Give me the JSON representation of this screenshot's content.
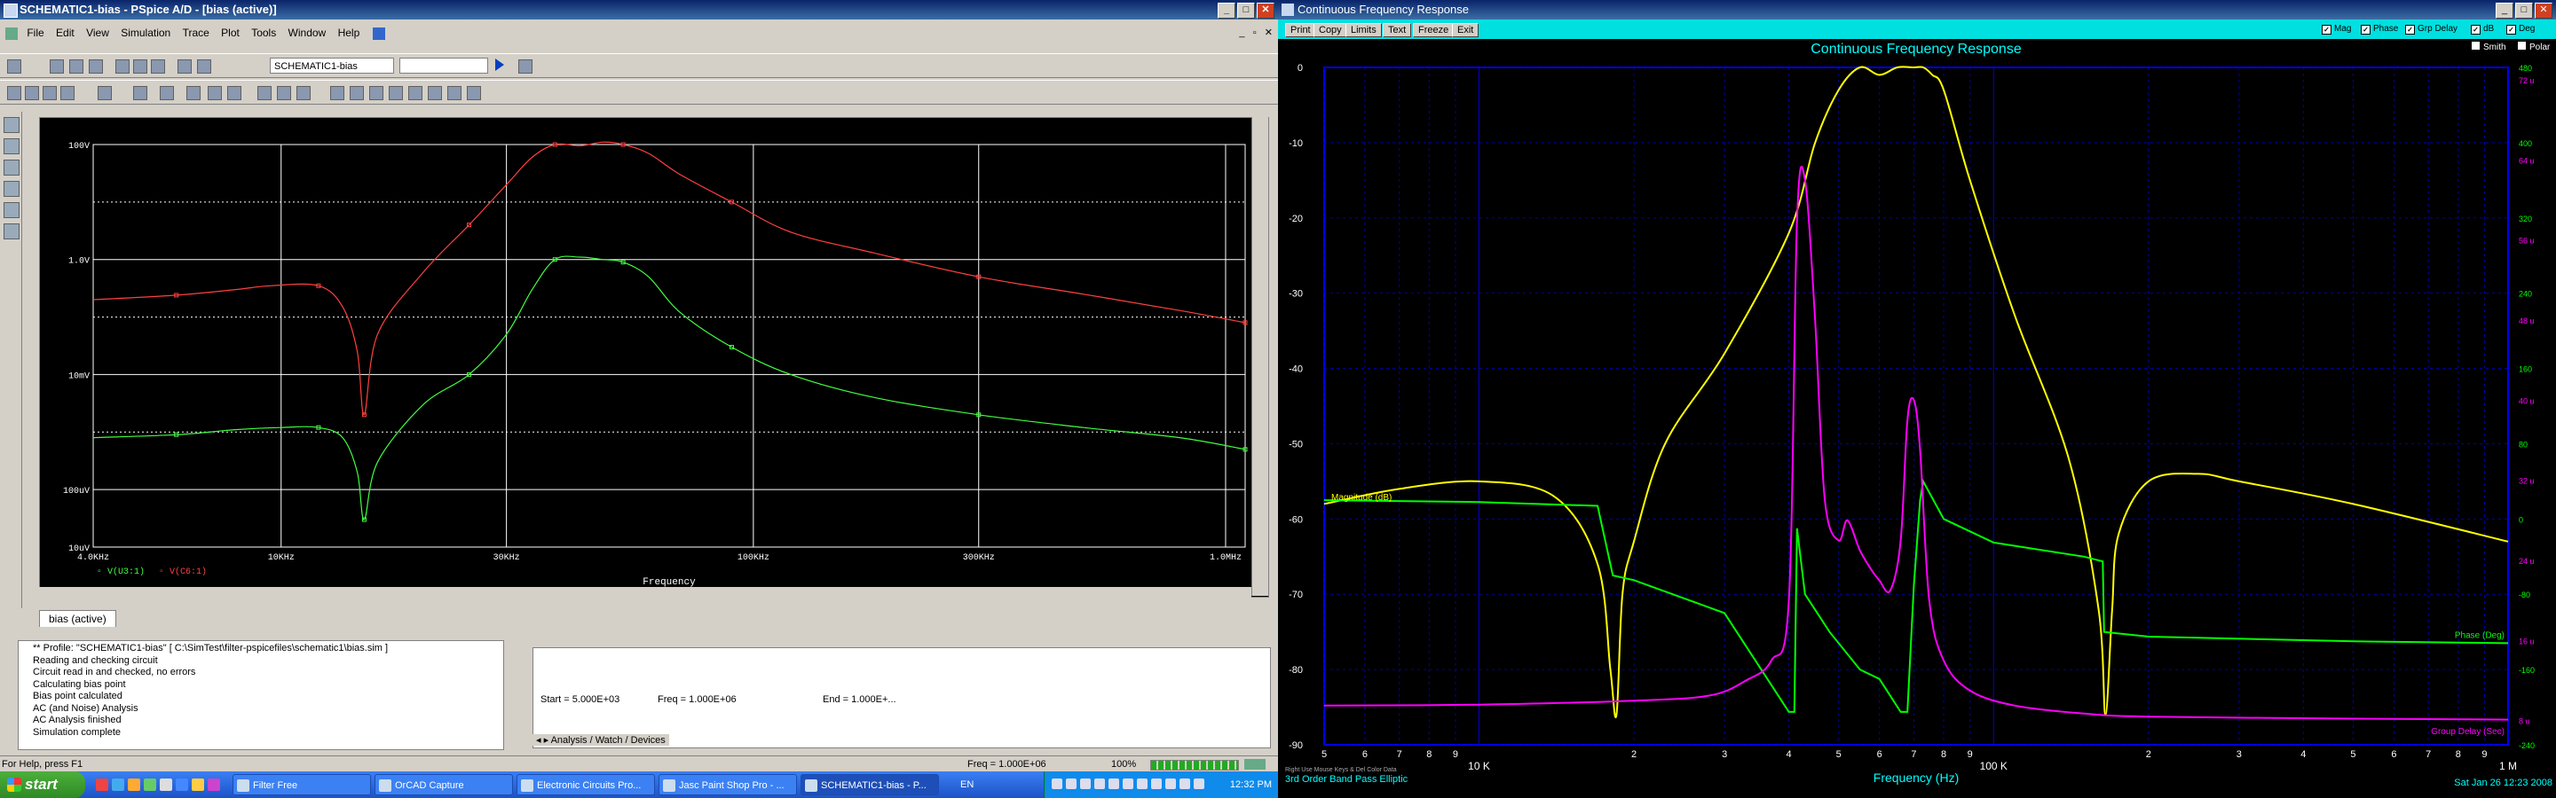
{
  "left_window": {
    "title": "SCHEMATIC1-bias - PSpice A/D - [bias (active)]",
    "menus": [
      "File",
      "Edit",
      "View",
      "Simulation",
      "Trace",
      "Plot",
      "Tools",
      "Window",
      "Help"
    ],
    "toolbar": {
      "profile_value": "SCHEMATIC1-bias",
      "second_value": ""
    },
    "plot": {
      "y_ticks": [
        "100V",
        "1.0V",
        "10mV",
        "100uV",
        "10uV"
      ],
      "x_ticks": [
        "4.0KHz",
        "10KHz",
        "30KHz",
        "100KHz",
        "300KHz",
        "1.0MHz"
      ],
      "x_label": "Frequency",
      "legend": [
        "V(U3:1)",
        "V(C6:1)"
      ]
    },
    "tab": "bias (active)",
    "output_lines": [
      "** Profile: \"SCHEMATIC1-bias\"  [ C:\\SimTest\\filter-pspicefiles\\schematic1\\bias.sim ]",
      "Reading and checking circuit",
      "Circuit read in and checked, no errors",
      "Calculating bias point",
      "Bias point calculated",
      "AC (and Noise) Analysis",
      "AC Analysis finished",
      "Simulation complete"
    ],
    "sim_status": {
      "start": "Start = 5.000E+03",
      "freq": "Freq = 1.000E+06",
      "end": "End = 1.000E+..."
    },
    "sim_tabs": [
      "Analysis",
      "Watch",
      "Devices"
    ],
    "status": {
      "help": "For Help, press F1",
      "freq": "Freq = 1.000E+06",
      "percent": "100%"
    }
  },
  "taskbar": {
    "start": "start",
    "buttons": [
      "Filter Free",
      "OrCAD Capture",
      "Electronic Circuits Pro...",
      "Jasc Paint Shop Pro - ...",
      "SCHEMATIC1-bias - P..."
    ],
    "lang": "EN",
    "clock": "12:32 PM"
  },
  "right_window": {
    "title": "Continuous Frequency Response",
    "buttons": [
      "Print",
      "Copy",
      "Limits",
      "Text",
      "Freeze",
      "Exit"
    ],
    "checkboxes": [
      "Mag",
      "Phase",
      "Grp Delay",
      "dB",
      "Deg",
      "Smith",
      "Polar"
    ],
    "chart_title": "Continuous Frequency Response",
    "left_ticks": [
      "0",
      "-10",
      "-20",
      "-30",
      "-40",
      "-50",
      "-60",
      "-70",
      "-80",
      "-90"
    ],
    "right_deg_ticks": [
      "480",
      "400",
      "320",
      "240",
      "160",
      "80",
      "0",
      "-80",
      "-160",
      "-240"
    ],
    "right_us_ticks": [
      "72 u",
      "64 u",
      "56 u",
      "48 u",
      "40 u",
      "32 u",
      "24 u",
      "16 u",
      "8 u"
    ],
    "x_ticks_top": [
      "5",
      "6",
      "7",
      "8",
      "9",
      "2",
      "3",
      "4",
      "5",
      "6",
      "7",
      "8",
      "9",
      "2",
      "3",
      "4",
      "5",
      "6",
      "7",
      "8",
      "9"
    ],
    "x_major": [
      "10 K",
      "100 K",
      "1 M"
    ],
    "x_label": "Frequency (Hz)",
    "series_labels": {
      "mag": "Magnitude (dB)",
      "phase": "Phase (Deg)",
      "gd": "Group Delay (Sec)"
    },
    "footer": {
      "hint": "Right Use Mouse Keys & Del Color Data",
      "filter": "3rd Order Band Pass Elliptic",
      "date": "Sat Jan 26 12:23 2008"
    },
    "colors": {
      "mag": "#ffff00",
      "phase": "#00ff00",
      "gd": "#ff00ff",
      "title": "#00ffff"
    }
  },
  "chart_data": [
    {
      "type": "line",
      "xlabel": "Frequency",
      "ylabel": "",
      "x_scale": "log",
      "xlim": [
        4000,
        1100000
      ],
      "y_scale": "log",
      "ylim_V": [
        1e-05,
        100
      ],
      "series": [
        {
          "name": "V(C6:1)",
          "color": "#ff4040",
          "x": [
            4000,
            6000,
            8000,
            9500,
            12000,
            13500,
            14500,
            15000,
            16000,
            20000,
            25000,
            30000,
            34000,
            38000,
            43000,
            48000,
            53000,
            60000,
            70000,
            90000,
            120000,
            180000,
            300000,
            500000,
            800000,
            1100000
          ],
          "y": [
            0.2,
            0.24,
            0.3,
            0.35,
            0.35,
            0.15,
            0.025,
            0.002,
            0.05,
            0.6,
            4,
            20,
            60,
            100,
            95,
            110,
            100,
            70,
            30,
            10,
            3,
            1.3,
            0.5,
            0.25,
            0.13,
            0.08
          ]
        },
        {
          "name": "V(U3:1)",
          "color": "#40ff40",
          "x": [
            4000,
            6000,
            8000,
            10000,
            12000,
            13500,
            14500,
            15000,
            16000,
            20000,
            25000,
            30000,
            34000,
            38000,
            43000,
            48000,
            53000,
            60000,
            70000,
            90000,
            120000,
            180000,
            300000,
            500000,
            800000,
            1100000
          ],
          "y": [
            0.0008,
            0.0009,
            0.0011,
            0.0012,
            0.0012,
            0.0008,
            0.0002,
            3e-05,
            0.0003,
            0.003,
            0.01,
            0.05,
            0.3,
            1,
            1.1,
            1,
            0.9,
            0.5,
            0.12,
            0.03,
            0.01,
            0.004,
            0.002,
            0.0012,
            0.0008,
            0.0005
          ]
        }
      ]
    },
    {
      "type": "line",
      "title": "Continuous Frequency Response",
      "xlabel": "Frequency (Hz)",
      "x_scale": "log",
      "xlim": [
        5000,
        1000000
      ],
      "ylim_left": [
        -90,
        0
      ],
      "ylim_right_deg": [
        -240,
        480
      ],
      "ylim_right_sec_us": [
        8,
        72
      ],
      "grid": true,
      "series": [
        {
          "name": "Magnitude (dB)",
          "axis": "left",
          "x": [
            5000,
            7000,
            10000,
            14000,
            17000,
            18000,
            18500,
            19000,
            20000,
            23000,
            30000,
            40000,
            45000,
            50000,
            55000,
            60000,
            65000,
            70000,
            73000,
            76000,
            80000,
            90000,
            110000,
            140000,
            160000,
            165000,
            170000,
            175000,
            200000,
            250000,
            300000,
            500000,
            1000000
          ],
          "y": [
            -58,
            -56,
            -55,
            -57,
            -66,
            -80,
            -86,
            -70,
            -63,
            -50,
            -38,
            -22,
            -10,
            -3,
            0,
            -1,
            0,
            0,
            0,
            -1,
            -3,
            -15,
            -33,
            -52,
            -72,
            -86,
            -72,
            -62,
            -55,
            -54,
            -55,
            -58,
            -63
          ]
        },
        {
          "name": "Phase (Deg)",
          "axis": "right_deg",
          "x": [
            5000,
            10000,
            17000,
            18200,
            20000,
            30000,
            40000,
            41000,
            41500,
            43000,
            48000,
            55000,
            60000,
            66000,
            68000,
            70000,
            72000,
            73000,
            80000,
            100000,
            150000,
            163000,
            164000,
            200000,
            500000,
            1000000
          ],
          "y": [
            20,
            18,
            14,
            -60,
            -65,
            -100,
            -205,
            -205,
            -10,
            -80,
            -120,
            -160,
            -170,
            -205,
            -205,
            -70,
            20,
            40,
            0,
            -25,
            -40,
            -45,
            -120,
            -125,
            -130,
            -132
          ]
        },
        {
          "name": "Group Delay (Sec)",
          "axis": "right_sec_us",
          "x": [
            5000,
            10000,
            20000,
            28000,
            33000,
            37000,
            40000,
            41500,
            43000,
            45000,
            47000,
            50000,
            52000,
            55000,
            58000,
            60000,
            63000,
            66000,
            68000,
            70000,
            72000,
            75000,
            80000,
            90000,
            110000,
            150000,
            200000,
            500000,
            1000000
          ],
          "y": [
            9.5,
            9.6,
            10,
            10.5,
            12,
            14,
            20,
            58,
            62,
            48,
            30,
            26,
            28,
            25,
            23,
            22,
            21,
            26,
            38,
            40,
            35,
            20,
            14,
            11,
            9.5,
            8.7,
            8.4,
            8.2,
            8.1
          ]
        }
      ]
    }
  ]
}
